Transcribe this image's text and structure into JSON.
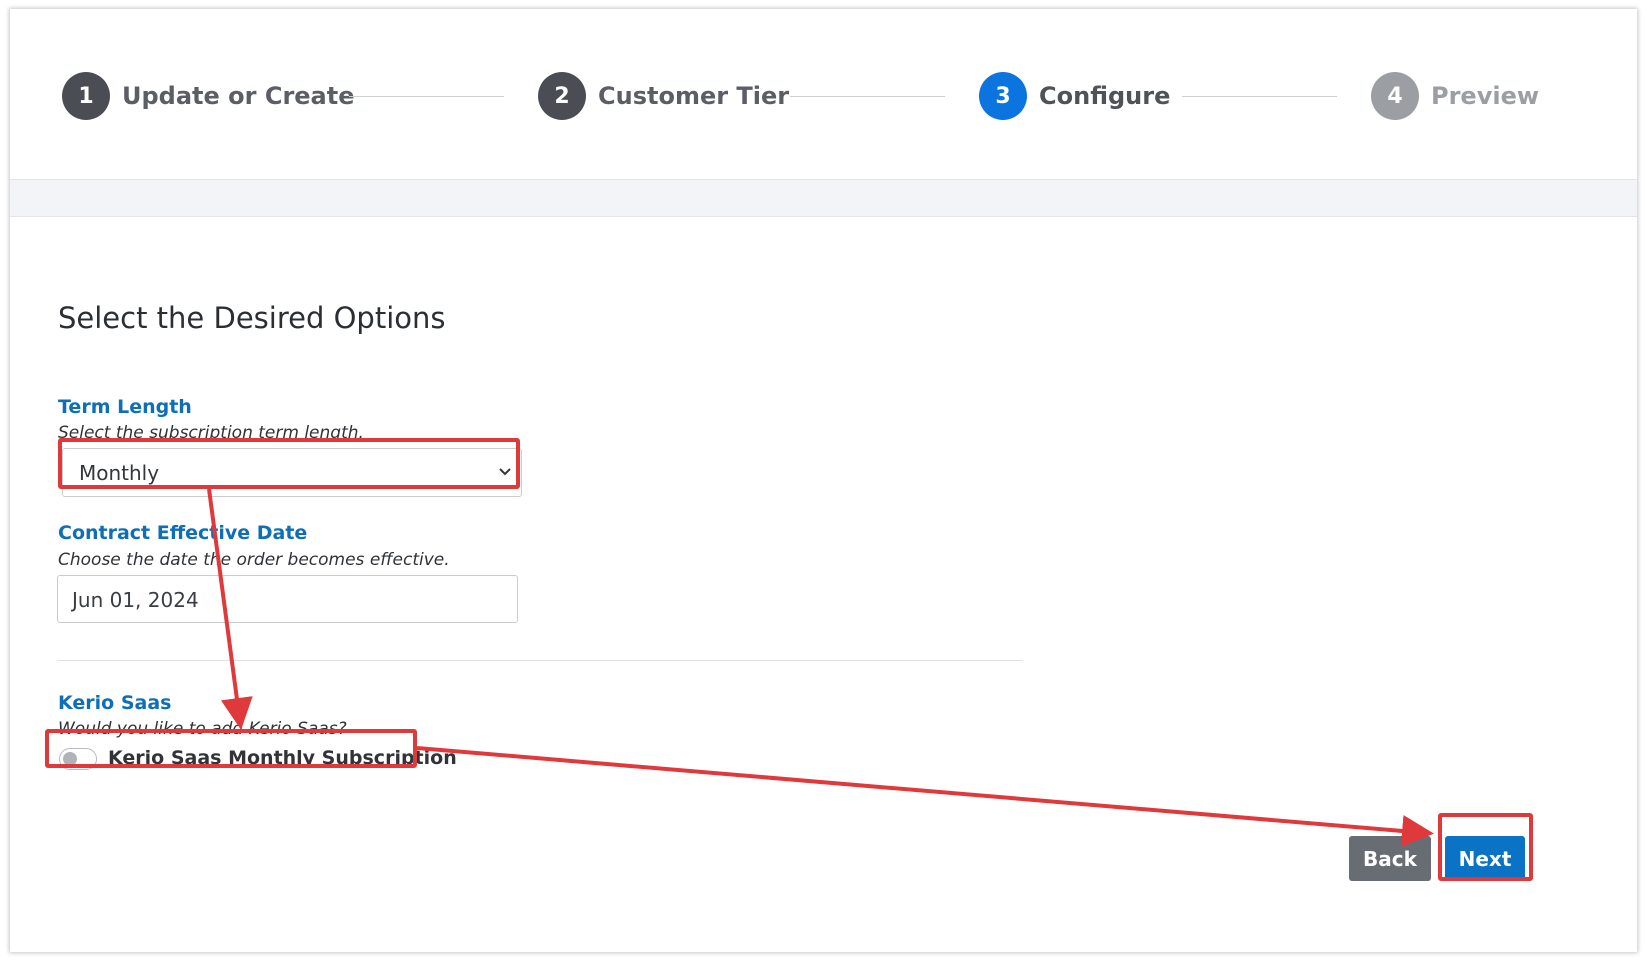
{
  "stepper": {
    "steps": [
      {
        "number": "1",
        "label": "Update or Create",
        "state": "done"
      },
      {
        "number": "2",
        "label": "Customer Tier",
        "state": "done"
      },
      {
        "number": "3",
        "label": "Configure",
        "state": "active"
      },
      {
        "number": "4",
        "label": "Preview",
        "state": "todo"
      }
    ]
  },
  "form": {
    "heading": "Select the Desired Options",
    "term_length": {
      "title": "Term Length",
      "help": "Select the subscription term length.",
      "selected": "Monthly"
    },
    "contract_date": {
      "title": "Contract Effective Date",
      "help": "Choose the date the order becomes effective.",
      "value": "Jun 01, 2024"
    },
    "kerio_saas": {
      "title": "Kerio Saas",
      "help": "Would you like to add Kerio Saas?",
      "toggle_label": "Kerio Saas Monthly Subscription",
      "enabled": false
    }
  },
  "actions": {
    "back_label": "Back",
    "next_label": "Next"
  },
  "colors": {
    "accent": "#0b74de",
    "title_blue": "#0e6fb6",
    "annotation_red": "#e0393b"
  },
  "icons": {
    "select_chevron": "chevron-down-icon"
  }
}
